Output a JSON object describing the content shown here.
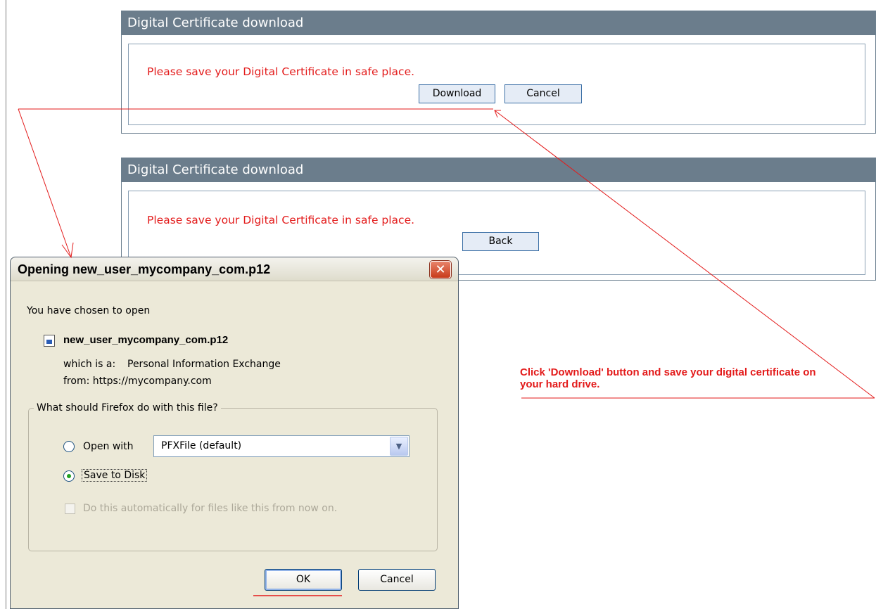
{
  "panel_top": {
    "title": "Digital Certificate download",
    "message": "Please save your Digital Certificate in safe place.",
    "download_label": "Download",
    "cancel_label": "Cancel"
  },
  "panel_bottom": {
    "title": "Digital Certificate download",
    "message": "Please save your Digital Certificate in safe place.",
    "back_label": "Back"
  },
  "dialog": {
    "title": "Opening new_user_mycompany_com.p12",
    "close_glyph": "✕",
    "chosen_text": "You have chosen to open",
    "file_name": "new_user_mycompany_com.p12",
    "which_is_label": "which is a:",
    "which_is_value": "Personal Information Exchange",
    "from_text": "from: https://mycompany.com",
    "group_label": "What should Firefox do with this file?",
    "open_with_label": "Open with",
    "open_with_checked": false,
    "open_with_value": "PFXFile (default)",
    "save_to_disk_label": "Save to Disk",
    "save_to_disk_checked": true,
    "auto_label": "Do this automatically for files like this from now on.",
    "auto_checked": false,
    "auto_disabled": true,
    "ok_label": "OK",
    "cancel_label": "Cancel",
    "icons": {
      "file": "pfx-file-icon",
      "dropdown": "chevron-down-icon",
      "close": "close-icon"
    }
  },
  "annotation": {
    "text": "Click 'Download' button and save your digital certificate on your hard drive."
  },
  "colors": {
    "panel_header": "#6b7d8c",
    "message_red": "#e31b1b",
    "annotation_red": "#e31b1b",
    "dialog_bg": "#ece9d8",
    "close_red": "#c83a1b"
  }
}
